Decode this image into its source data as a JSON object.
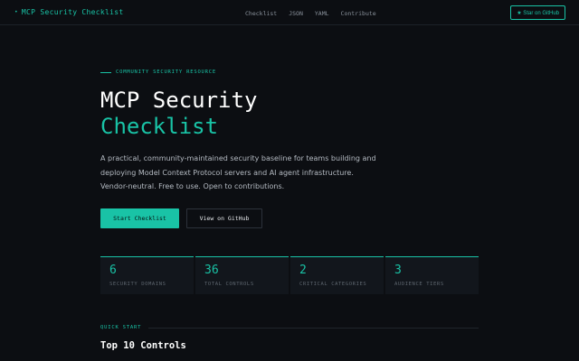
{
  "header": {
    "logo_bullet": "•",
    "logo_text": "MCP Security Checklist",
    "nav": [
      "Checklist",
      "JSON",
      "YAML",
      "Contribute"
    ],
    "star_icon": "star-icon",
    "star_label": "★ Star on GitHub"
  },
  "hero": {
    "eyebrow": "COMMUNITY SECURITY RESOURCE",
    "title_line1": "MCP Security",
    "title_line2": "Checklist",
    "description": "A practical, community-maintained security baseline for teams building and deploying Model Context Protocol servers and AI agent infrastructure. Vendor-neutral. Free to use. Open to contributions.",
    "primary_button": "Start Checklist",
    "secondary_button": "View on GitHub"
  },
  "stats": [
    {
      "value": "6",
      "label": "SECURITY DOMAINS"
    },
    {
      "value": "36",
      "label": "TOTAL CONTROLS"
    },
    {
      "value": "2",
      "label": "CRITICAL CATEGORIES"
    },
    {
      "value": "3",
      "label": "AUDIENCE TIERS"
    }
  ],
  "quick_start": {
    "eyebrow": "QUICK START",
    "title": "Top 10 Controls"
  },
  "colors": {
    "accent": "#19c3a6",
    "background": "#0c0e12"
  }
}
